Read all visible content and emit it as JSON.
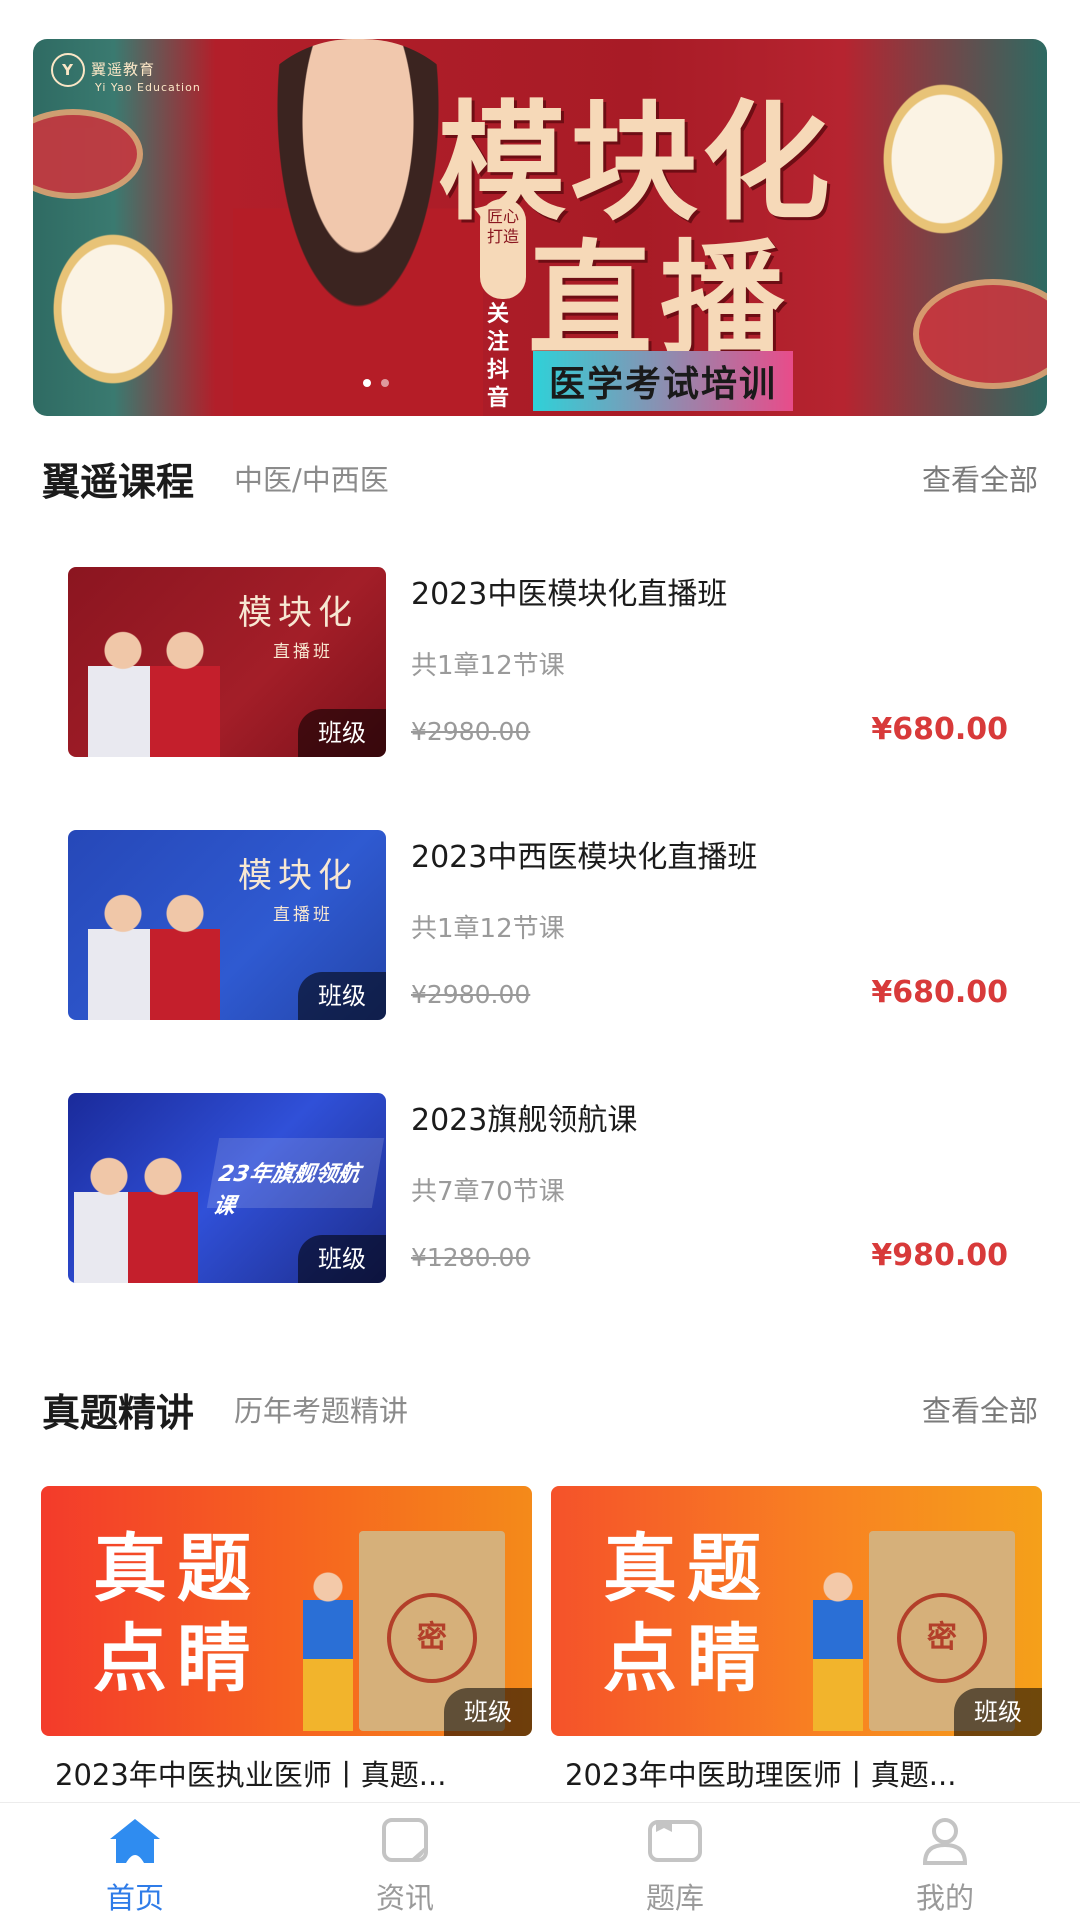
{
  "banner": {
    "logo_text": "翼遥教育",
    "logo_sub": "Yi Yao Education",
    "title_line1": "模块化",
    "title_line2": "直播",
    "seal_text": "匠心打造",
    "follow_text": "关注抖音",
    "subtitle": "医学考试培训",
    "carousel_index": 1,
    "carousel_count": 2
  },
  "section_courses": {
    "title": "翼遥课程",
    "subtitle": "中医/中西医",
    "more": "查看全部"
  },
  "courses": [
    {
      "thumb_title": "模块化",
      "thumb_sub": "直播班",
      "badge": "班级",
      "name": "2023中医模块化直播班",
      "lessons": "共1章12节课",
      "original_price": "¥2980.00",
      "price": "¥680.00"
    },
    {
      "thumb_title": "模块化",
      "thumb_sub": "直播班",
      "badge": "班级",
      "name": "2023中西医模块化直播班",
      "lessons": "共1章12节课",
      "original_price": "¥2980.00",
      "price": "¥680.00"
    },
    {
      "thumb_title": "23年旗舰领航课",
      "badge": "班级",
      "name": "2023旗舰领航课",
      "lessons": "共7章70节课",
      "original_price": "¥1280.00",
      "price": "¥980.00"
    }
  ],
  "section_exams": {
    "title": "真题精讲",
    "subtitle": "历年考题精讲",
    "more": "查看全部"
  },
  "exam_cards": [
    {
      "cover_line1": "真题",
      "cover_line2": "点睛",
      "seal": "密",
      "badge": "班级",
      "title": "2023年中医执业医师丨真题..."
    },
    {
      "cover_line1": "真题",
      "cover_line2": "点睛",
      "seal": "密",
      "badge": "班级",
      "title": "2023年中医助理医师丨真题..."
    }
  ],
  "tabbar": {
    "items": [
      {
        "label": "首页",
        "icon": "home-icon",
        "active": true
      },
      {
        "label": "资讯",
        "icon": "news-icon",
        "active": false
      },
      {
        "label": "题库",
        "icon": "question-bank-icon",
        "active": false
      },
      {
        "label": "我的",
        "icon": "profile-icon",
        "active": false
      }
    ],
    "active_color": "#2f7ce8",
    "inactive_color": "#9a9a9a"
  },
  "colors": {
    "price_red": "#d83a3a",
    "badge_bg": "rgba(0,0,0,0.55)"
  }
}
